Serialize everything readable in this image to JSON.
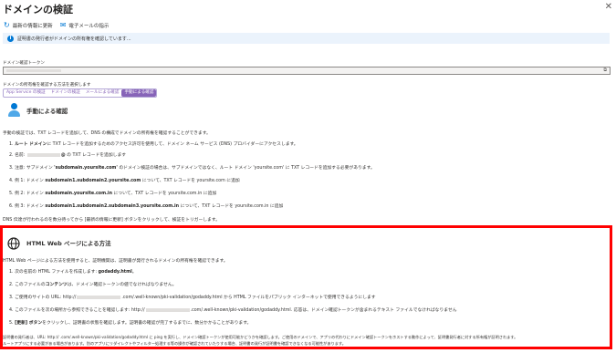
{
  "header": {
    "title": "ドメインの検証",
    "ellipsis": "···",
    "close": "✕"
  },
  "toolbar": {
    "refresh_label": "最新の情報に更新",
    "feedback_label": "電子メールの指示"
  },
  "info": {
    "text": "証明書の発行者がドメインの所有権を確認しています..."
  },
  "token": {
    "label": "ドメイン確認トークン"
  },
  "method": {
    "label": "ドメインの所有権を確認する方法を選択します",
    "tabs": [
      {
        "label": "App Service の検証",
        "selected": false
      },
      {
        "label": "ドメインの検証",
        "selected": false
      },
      {
        "label": "メールによる確認",
        "selected": false
      },
      {
        "label": "手動による確認",
        "selected": true
      }
    ]
  },
  "manual": {
    "title": "手動による確認",
    "intro": "手動の検証では、TXT レコードを追加して、DNS の構成でドメインの所有権を確認することができます。",
    "steps": [
      {
        "pre": "1. ",
        "bold": "ルート ドメイン",
        "post": "に TXT レコードを追加するためのアクセス許可を使用して、ドメイン ネーム サービス (DNS) プロバイダーにアクセスします。"
      },
      {
        "pre": "2. 名前: ",
        "bold": "@",
        "post": " の TXT レコードを追加します"
      },
      {
        "pre": "3. 注意: サブドメイン ",
        "bold": "'subdomain.yoursite.com'",
        "post": " のドメイン検証の場合は、サブドメインではなく、ルート ドメイン 'yoursite.com' に TXT レコードを追加する必要があります。"
      },
      {
        "pre": "4. 例 1: ドメイン ",
        "bold": "subdomain1.subdomain2.yoursite.com",
        "post": " について、TXT レコードを yoursite.com に追加"
      },
      {
        "pre": "5. 例 2: ドメイン ",
        "bold": "subdomain.yoursite.com.in",
        "post": " について、TXT レコードを yoursite.com.in に追加"
      },
      {
        "pre": "6. 例 3: ドメイン ",
        "bold": "subdomain1.subdomain2.subdomain3.yoursite.com.in",
        "post": " について、TXT レコードを yoursite.com.in に追加"
      }
    ],
    "footer": "DNS 伝達が行われるのを数分待ってから [最新の情報に更新] ボタンをクリックして、検証をトリガーします。"
  },
  "html_web": {
    "title": "HTML Web ページによる方法",
    "intro": "HTML Web ページによる方法を使用すると、証明機関は、証明書が発行されるドメインの所有権を確認できます。",
    "steps": [
      {
        "pre": "1. 次の名前の HTML ファイルを作成します: ",
        "bold": "godaddy.html",
        "post": "。"
      },
      {
        "pre": "2. このファイルの",
        "bold": "コンテンツ",
        "post": "は、ドメイン確認トークンの値でなければなりません。"
      },
      {
        "pre": "3. ご使用のサイトの URL: http://",
        "bold": "",
        "post": ".com/.well-known/pki-validation/godaddy.html から HTML ファイルをパブリック インターネットで使用できるようにします"
      },
      {
        "pre": "4. このファイルを次の場所から参照できることを確認します: http://",
        "bold": "",
        "post": ".com/.well-known/pki-validation/godaddy.html. 応答は、ドメイン確認トークンが含まれるテキスト ファイルでなければなりません"
      },
      {
        "pre": "5. ",
        "bold": "[更新] ボタン",
        "post": "をクリックし、証明書の状態を確認します。証明書の確認が完了するまでに、数分かかることがあります。"
      }
    ],
    "footer_1": "証明書の発行者は、URL: http://                    .com/.well-known/pki-validation/godaddy.html に ping を実行し、ドメイン確認トークンが使用可能かどうかを確認します。ご使用のドメインで、アプリの代わりにドメイン確認トークンをホストする動作によって、証明書発行者に対する所有権が証明されます。",
    "footer_2": "ルートアプリにする必要がある場合があります。別のアプリにリダイレクトやフィルター処理する等の操作が確認されていたりする場合、証明書の発行が証明書を確認できなくなる可能性があります。"
  },
  "colors": {
    "accent": "#0078d4",
    "tab_purple": "#8764b8",
    "highlight_red": "#ff0000",
    "info_bg": "#ebf3fc"
  },
  "icons": [
    "refresh-icon",
    "mail-icon",
    "info-icon",
    "copy-icon",
    "person-icon",
    "globe-icon",
    "close-icon"
  ]
}
